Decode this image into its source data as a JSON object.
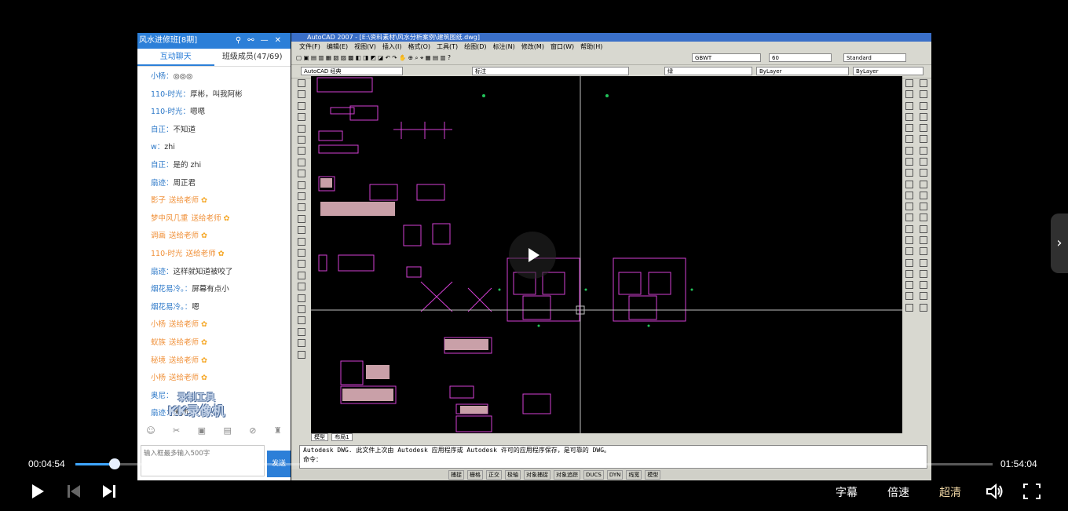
{
  "chat": {
    "title": "风水进修班[8期]",
    "tabs": [
      "互动聊天",
      "班级成员(47/69)"
    ],
    "messages": [
      {
        "user": "小杨：",
        "text": "◎◎◎",
        "style": "normal"
      },
      {
        "user": "110-时光：",
        "text": "厚彬，叫我阿彬",
        "style": "normal"
      },
      {
        "user": "110-时光：",
        "text": "嗯嗯",
        "style": "normal"
      },
      {
        "user": "自正：",
        "text": "不知道",
        "style": "normal"
      },
      {
        "user": "w：",
        "text": "zhi",
        "style": "normal"
      },
      {
        "user": "自正：",
        "text": "是的 zhi",
        "style": "normal"
      },
      {
        "user": "扇迹：",
        "text": "周正君",
        "style": "normal"
      },
      {
        "user": "影子",
        "text": "送给老师",
        "style": "orange"
      },
      {
        "user": "梦中风几重",
        "text": "送给老师",
        "style": "orange"
      },
      {
        "user": "调画",
        "text": "送给老师",
        "style": "orange"
      },
      {
        "user": "110-时光",
        "text": "送给老师",
        "style": "orange"
      },
      {
        "user": "扇迹：",
        "text": "这样就知道被咬了",
        "style": "normal"
      },
      {
        "user": "烟花易冷。：",
        "text": "屏幕有点小",
        "style": "normal"
      },
      {
        "user": "烟花易冷。：",
        "text": "嗯",
        "style": "normal"
      },
      {
        "user": "小杨",
        "text": "送给老师",
        "style": "orange"
      },
      {
        "user": "蚁族",
        "text": "送给老师",
        "style": "orange"
      },
      {
        "user": "秘境",
        "text": "送给老师",
        "style": "orange"
      },
      {
        "user": "小杨",
        "text": "送给老师",
        "style": "orange"
      },
      {
        "user": "奥尼：",
        "text": "",
        "style": "normal"
      },
      {
        "user": "扇迹：",
        "text": "大师",
        "style": "normal"
      }
    ],
    "watermark_line1": "录制工具",
    "watermark_line2": "KK录像机",
    "input_placeholder": "输入框最多输入500字",
    "send_label": "发送"
  },
  "cad": {
    "title": "AutoCAD 2007 - [E:\\资料素材\\风水分析案例\\建筑图纸.dwg]",
    "menu": [
      "文件(F)",
      "编辑(E)",
      "视图(V)",
      "插入(I)",
      "格式(O)",
      "工具(T)",
      "绘图(D)",
      "标注(N)",
      "修改(M)",
      "窗口(W)",
      "帮助(H)"
    ],
    "text_style": "GBWT",
    "text_height": "60",
    "dim_style": "Standard",
    "workspace": "AutoCAD 经典",
    "layer": "标注",
    "color": "绿",
    "linetype": "ByLayer",
    "lineweight": "ByLayer",
    "layout_tabs": [
      "模型",
      "布局1"
    ],
    "command_line1": "Autodesk DWG.  此文件上次由 Autodesk 应用程序或 Autodesk 许可的应用程序保存，是可靠的 DWG。",
    "command_line2": "命令：",
    "status_items": [
      "捕捉",
      "栅格",
      "正交",
      "极轴",
      "对象捕捉",
      "对象追踪",
      "DUCS",
      "DYN",
      "线宽",
      "模型"
    ]
  },
  "player": {
    "current_time": "00:04:54",
    "total_time": "01:54:04",
    "progress": 0.043,
    "subtitle_label": "字幕",
    "speed_label": "倍速",
    "quality_label": "超清",
    "accent": "#3ea6ff"
  }
}
